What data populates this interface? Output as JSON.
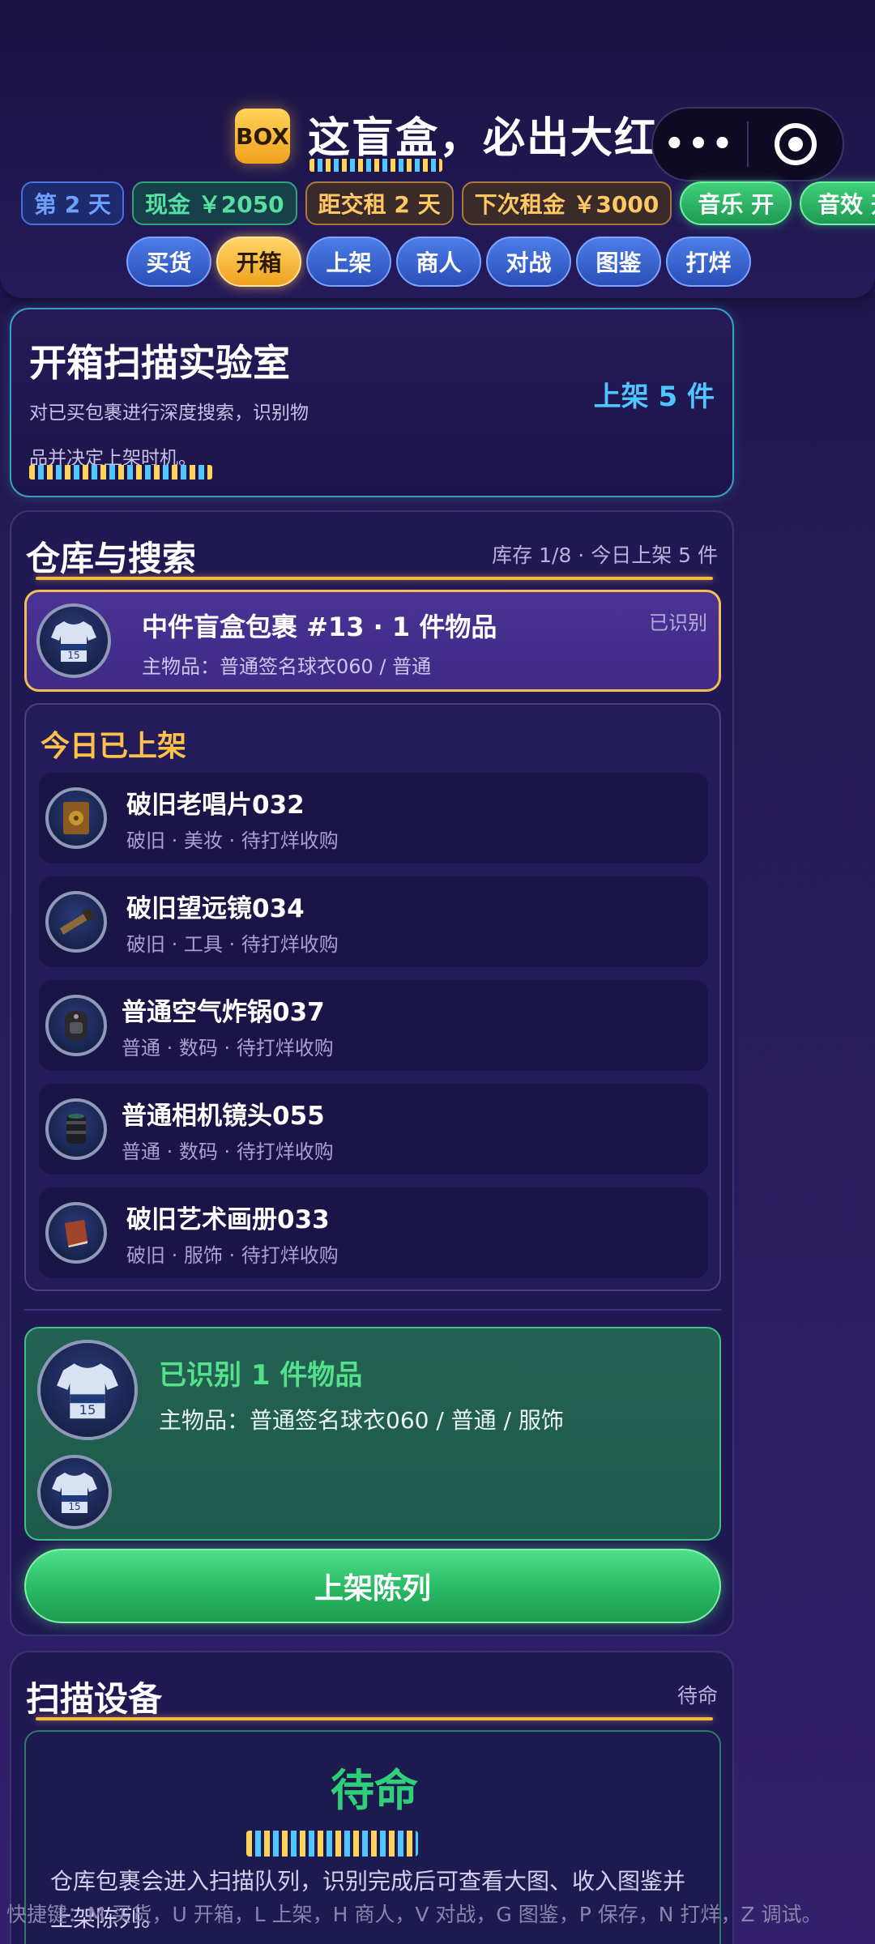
{
  "app": {
    "logo_text": "BOX",
    "title": "这盲盒，必出大红"
  },
  "capsule": {
    "more": "•••"
  },
  "stats": {
    "day": "第 2 天",
    "cash": "现金 ￥2050",
    "rent_due": "距交租 2 天",
    "next_rent": "下次租金 ￥3000",
    "music": "音乐 开",
    "sfx": "音效 开"
  },
  "nav": {
    "tabs": [
      "买货",
      "开箱",
      "上架",
      "商人",
      "对战",
      "图鉴",
      "打烊"
    ],
    "active": "开箱"
  },
  "lab": {
    "title": "开箱扫描实验室",
    "desc": "对已买包裹进行深度搜索，识别物品并决定上架时机。",
    "count": "上架 5 件"
  },
  "warehouse": {
    "title": "仓库与搜索",
    "meta": "库存 1/8 · 今日上架 5 件",
    "package": {
      "name": "中件盲盒包裹 #13 · 1 件物品",
      "sub": "主物品：普通签名球衣060 / 普通",
      "status": "已识别"
    },
    "listed_title": "今日已上架",
    "listed_items": [
      {
        "name": "破旧老唱片032",
        "meta": "破旧 · 美妆 · 待打烊收购",
        "icon": "record-icon"
      },
      {
        "name": "破旧望远镜034",
        "meta": "破旧 · 工具 · 待打烊收购",
        "icon": "telescope-icon"
      },
      {
        "name": "普通空气炸锅037",
        "meta": "普通 · 数码 · 待打烊收购",
        "icon": "air-fryer-icon"
      },
      {
        "name": "普通相机镜头055",
        "meta": "普通 · 数码 · 待打烊收购",
        "icon": "camera-lens-icon"
      },
      {
        "name": "破旧艺术画册033",
        "meta": "破旧 · 服饰 · 待打烊收购",
        "icon": "art-book-icon"
      }
    ],
    "identified": {
      "title": "已识别 1 件物品",
      "sub": "主物品：普通签名球衣060 / 普通 / 服饰"
    },
    "list_button": "上架陈列"
  },
  "scanner": {
    "title": "扫描设备",
    "status": "待命",
    "big_status": "待命",
    "desc": "仓库包裹会进入扫描队列，识别完成后可查看大图、收入图鉴并上架陈列。"
  },
  "footer": {
    "hint": "快捷键：M 买货，U 开箱，L 上架，H 商人，V 对战，G 图鉴，P 保存，N 打烊，Z 调试。"
  }
}
